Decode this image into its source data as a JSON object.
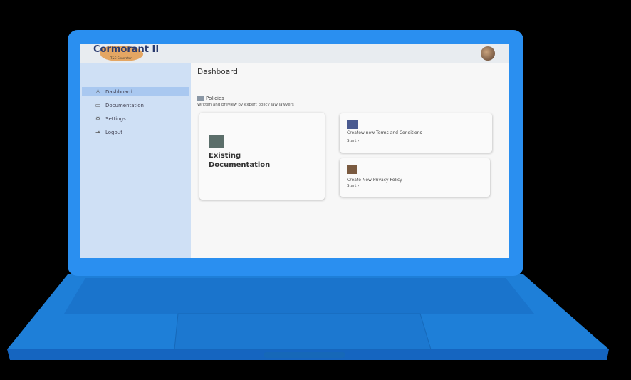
{
  "app": {
    "logo_text": "Cormorant II",
    "logo_subtext": "T&C Generator"
  },
  "sidebar": {
    "items": [
      {
        "label": "Dashboard",
        "icon": "user-icon",
        "active": true
      },
      {
        "label": "Documentation",
        "icon": "document-icon",
        "active": false
      },
      {
        "label": "Settings",
        "icon": "gear-icon",
        "active": false
      },
      {
        "label": "Logout",
        "icon": "logout-icon",
        "active": false
      }
    ]
  },
  "main": {
    "title": "Dashboard",
    "section_title": "Policies",
    "section_description": "Written and preview by expert policy law lawyers",
    "cards": [
      {
        "title": "Existing Documentation"
      },
      {
        "title": "Createw new Terms and Conditions",
        "action": "Start"
      },
      {
        "title": "Create New Privacy Policy",
        "action": "Start"
      }
    ]
  },
  "colors": {
    "laptop": "#2a8ff0",
    "sidebar": "#cfe0f5",
    "active_item": "#a9c8f0"
  }
}
